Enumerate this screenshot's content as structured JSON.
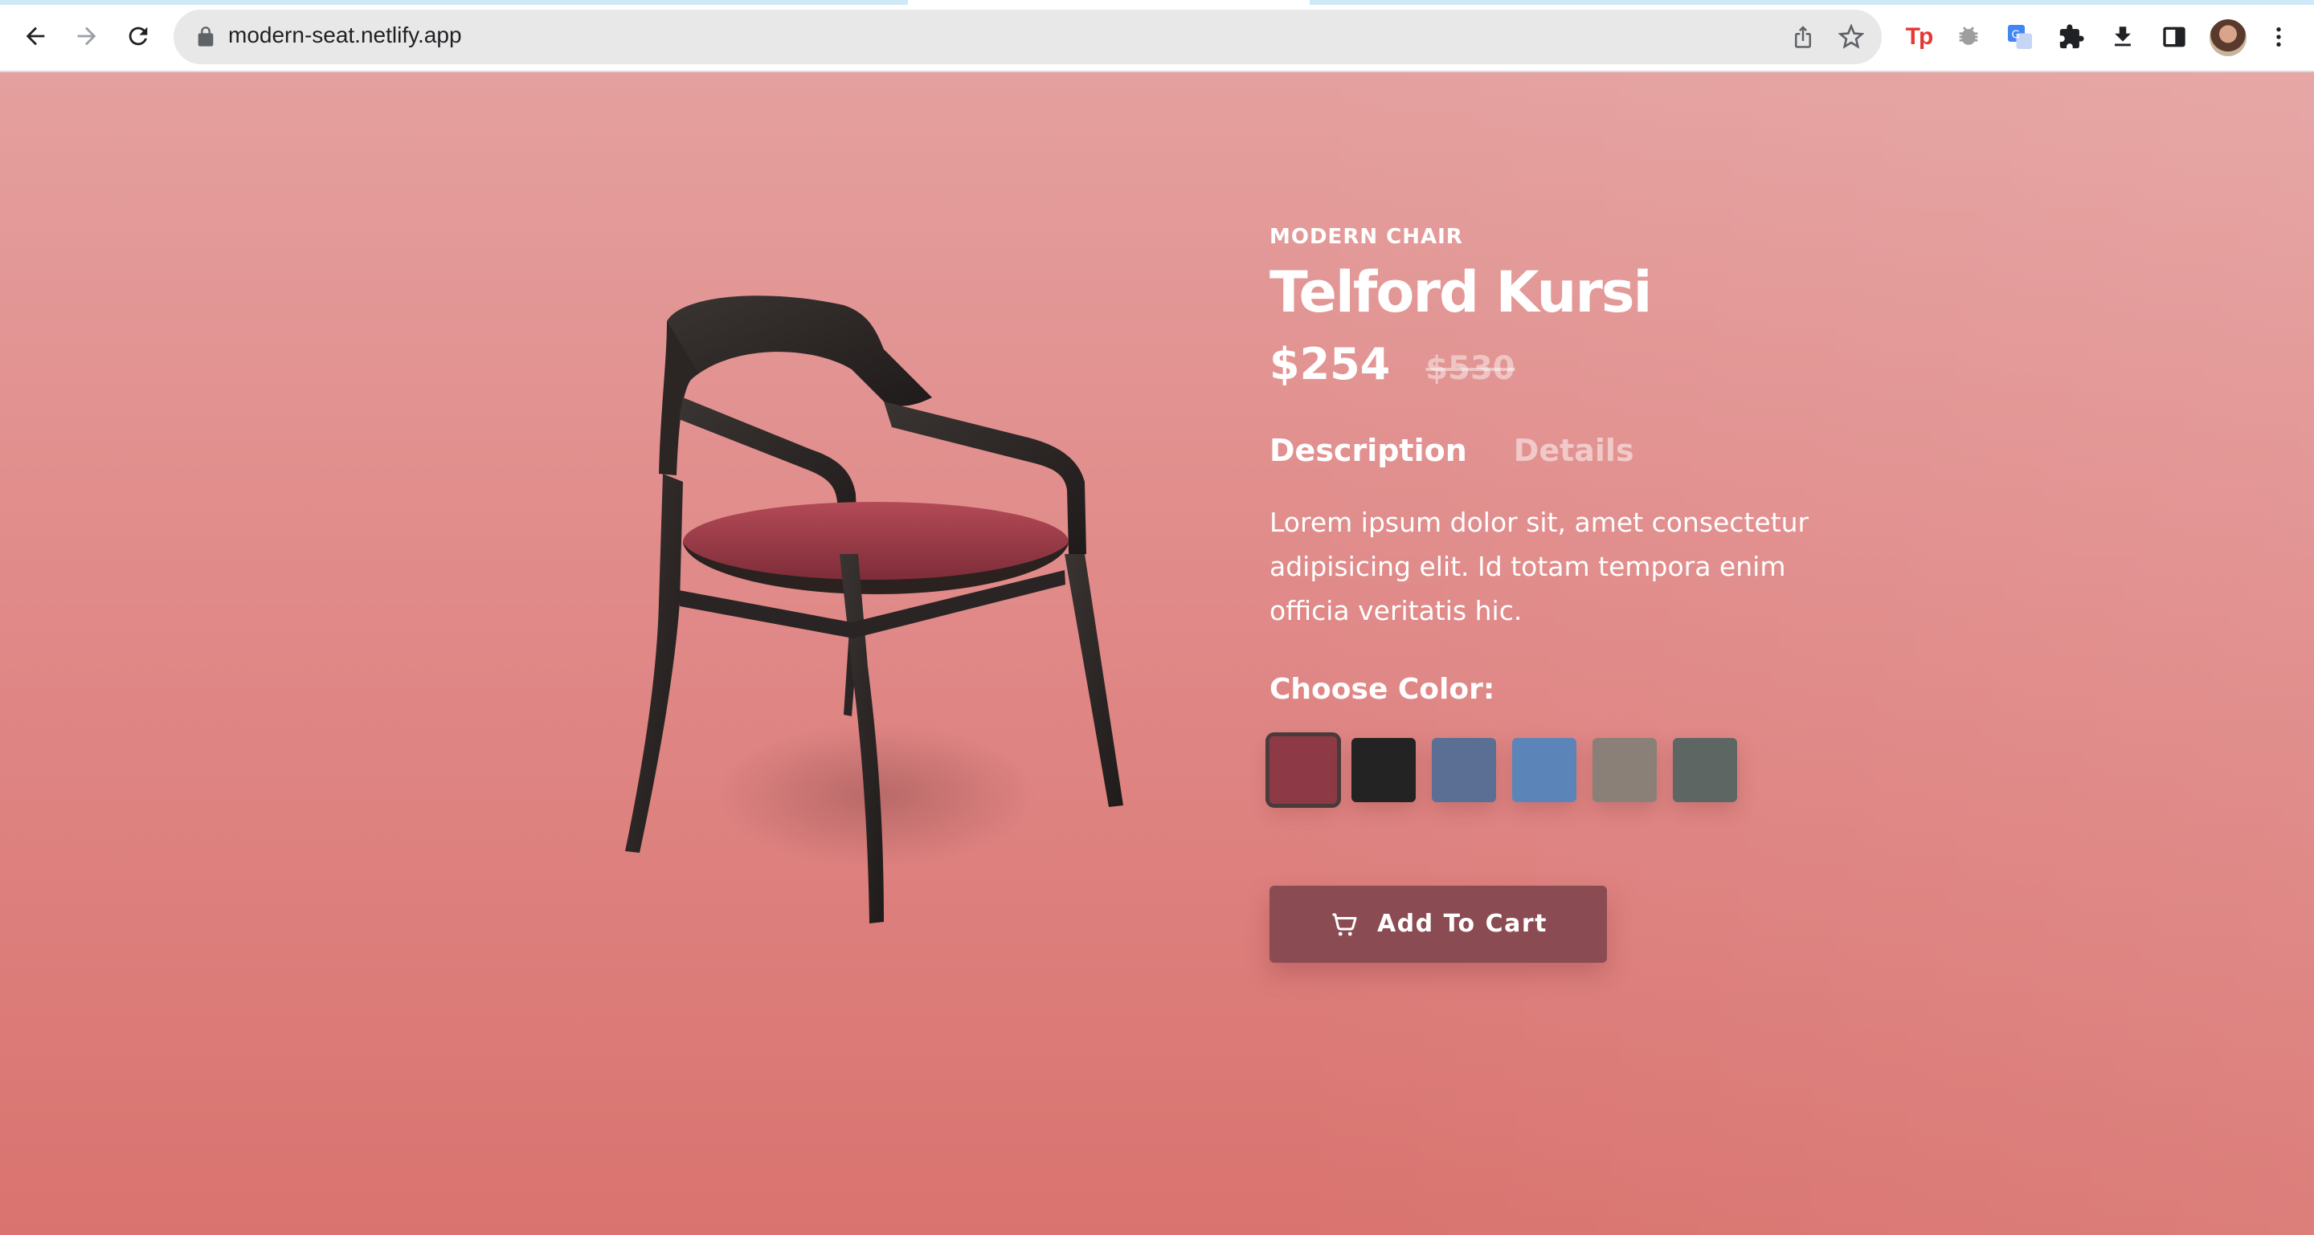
{
  "browser": {
    "url": "modern-seat.netlify.app",
    "extension_tp_label": "Tp",
    "icons": [
      "back-arrow-icon",
      "forward-arrow-icon",
      "reload-icon",
      "lock-icon",
      "share-icon",
      "star-icon",
      "bug-icon",
      "translate-icon",
      "puzzle-icon",
      "download-icon",
      "sidepanel-icon",
      "menu-dots-icon"
    ]
  },
  "product": {
    "category": "MODERN CHAIR",
    "name": "Telford Kursi",
    "price": "$254",
    "old_price": "$530",
    "tabs": [
      {
        "label": "Description",
        "active": true
      },
      {
        "label": "Details",
        "active": false
      }
    ],
    "description": "Lorem ipsum dolor sit, amet consectetur adipisicing elit. Id totam tempora enim officia veritatis hic.",
    "color_label": "Choose Color:",
    "colors": [
      {
        "name": "burgundy",
        "hex": "#8e3a46",
        "selected": true
      },
      {
        "name": "black",
        "hex": "#232323",
        "selected": false
      },
      {
        "name": "denim-blue",
        "hex": "#5a6f93",
        "selected": false
      },
      {
        "name": "light-blue",
        "hex": "#5b85b8",
        "selected": false
      },
      {
        "name": "taupe",
        "hex": "#8a8078",
        "selected": false
      },
      {
        "name": "slate-grey",
        "hex": "#5e6664",
        "selected": false
      }
    ],
    "cart_button": "Add To Cart"
  },
  "theme": {
    "background": "#e08a89",
    "button": "#8b4b52"
  }
}
